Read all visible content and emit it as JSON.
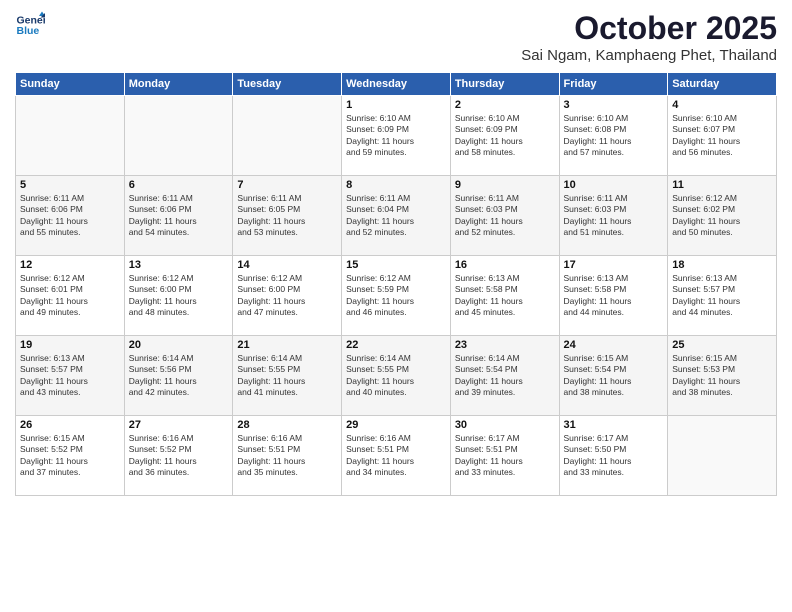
{
  "header": {
    "logo_line1": "General",
    "logo_line2": "Blue",
    "month": "October 2025",
    "location": "Sai Ngam, Kamphaeng Phet, Thailand"
  },
  "weekdays": [
    "Sunday",
    "Monday",
    "Tuesday",
    "Wednesday",
    "Thursday",
    "Friday",
    "Saturday"
  ],
  "weeks": [
    [
      {
        "day": "",
        "info": ""
      },
      {
        "day": "",
        "info": ""
      },
      {
        "day": "",
        "info": ""
      },
      {
        "day": "1",
        "info": "Sunrise: 6:10 AM\nSunset: 6:09 PM\nDaylight: 11 hours\nand 59 minutes."
      },
      {
        "day": "2",
        "info": "Sunrise: 6:10 AM\nSunset: 6:09 PM\nDaylight: 11 hours\nand 58 minutes."
      },
      {
        "day": "3",
        "info": "Sunrise: 6:10 AM\nSunset: 6:08 PM\nDaylight: 11 hours\nand 57 minutes."
      },
      {
        "day": "4",
        "info": "Sunrise: 6:10 AM\nSunset: 6:07 PM\nDaylight: 11 hours\nand 56 minutes."
      }
    ],
    [
      {
        "day": "5",
        "info": "Sunrise: 6:11 AM\nSunset: 6:06 PM\nDaylight: 11 hours\nand 55 minutes."
      },
      {
        "day": "6",
        "info": "Sunrise: 6:11 AM\nSunset: 6:06 PM\nDaylight: 11 hours\nand 54 minutes."
      },
      {
        "day": "7",
        "info": "Sunrise: 6:11 AM\nSunset: 6:05 PM\nDaylight: 11 hours\nand 53 minutes."
      },
      {
        "day": "8",
        "info": "Sunrise: 6:11 AM\nSunset: 6:04 PM\nDaylight: 11 hours\nand 52 minutes."
      },
      {
        "day": "9",
        "info": "Sunrise: 6:11 AM\nSunset: 6:03 PM\nDaylight: 11 hours\nand 52 minutes."
      },
      {
        "day": "10",
        "info": "Sunrise: 6:11 AM\nSunset: 6:03 PM\nDaylight: 11 hours\nand 51 minutes."
      },
      {
        "day": "11",
        "info": "Sunrise: 6:12 AM\nSunset: 6:02 PM\nDaylight: 11 hours\nand 50 minutes."
      }
    ],
    [
      {
        "day": "12",
        "info": "Sunrise: 6:12 AM\nSunset: 6:01 PM\nDaylight: 11 hours\nand 49 minutes."
      },
      {
        "day": "13",
        "info": "Sunrise: 6:12 AM\nSunset: 6:00 PM\nDaylight: 11 hours\nand 48 minutes."
      },
      {
        "day": "14",
        "info": "Sunrise: 6:12 AM\nSunset: 6:00 PM\nDaylight: 11 hours\nand 47 minutes."
      },
      {
        "day": "15",
        "info": "Sunrise: 6:12 AM\nSunset: 5:59 PM\nDaylight: 11 hours\nand 46 minutes."
      },
      {
        "day": "16",
        "info": "Sunrise: 6:13 AM\nSunset: 5:58 PM\nDaylight: 11 hours\nand 45 minutes."
      },
      {
        "day": "17",
        "info": "Sunrise: 6:13 AM\nSunset: 5:58 PM\nDaylight: 11 hours\nand 44 minutes."
      },
      {
        "day": "18",
        "info": "Sunrise: 6:13 AM\nSunset: 5:57 PM\nDaylight: 11 hours\nand 44 minutes."
      }
    ],
    [
      {
        "day": "19",
        "info": "Sunrise: 6:13 AM\nSunset: 5:57 PM\nDaylight: 11 hours\nand 43 minutes."
      },
      {
        "day": "20",
        "info": "Sunrise: 6:14 AM\nSunset: 5:56 PM\nDaylight: 11 hours\nand 42 minutes."
      },
      {
        "day": "21",
        "info": "Sunrise: 6:14 AM\nSunset: 5:55 PM\nDaylight: 11 hours\nand 41 minutes."
      },
      {
        "day": "22",
        "info": "Sunrise: 6:14 AM\nSunset: 5:55 PM\nDaylight: 11 hours\nand 40 minutes."
      },
      {
        "day": "23",
        "info": "Sunrise: 6:14 AM\nSunset: 5:54 PM\nDaylight: 11 hours\nand 39 minutes."
      },
      {
        "day": "24",
        "info": "Sunrise: 6:15 AM\nSunset: 5:54 PM\nDaylight: 11 hours\nand 38 minutes."
      },
      {
        "day": "25",
        "info": "Sunrise: 6:15 AM\nSunset: 5:53 PM\nDaylight: 11 hours\nand 38 minutes."
      }
    ],
    [
      {
        "day": "26",
        "info": "Sunrise: 6:15 AM\nSunset: 5:52 PM\nDaylight: 11 hours\nand 37 minutes."
      },
      {
        "day": "27",
        "info": "Sunrise: 6:16 AM\nSunset: 5:52 PM\nDaylight: 11 hours\nand 36 minutes."
      },
      {
        "day": "28",
        "info": "Sunrise: 6:16 AM\nSunset: 5:51 PM\nDaylight: 11 hours\nand 35 minutes."
      },
      {
        "day": "29",
        "info": "Sunrise: 6:16 AM\nSunset: 5:51 PM\nDaylight: 11 hours\nand 34 minutes."
      },
      {
        "day": "30",
        "info": "Sunrise: 6:17 AM\nSunset: 5:51 PM\nDaylight: 11 hours\nand 33 minutes."
      },
      {
        "day": "31",
        "info": "Sunrise: 6:17 AM\nSunset: 5:50 PM\nDaylight: 11 hours\nand 33 minutes."
      },
      {
        "day": "",
        "info": ""
      }
    ]
  ]
}
